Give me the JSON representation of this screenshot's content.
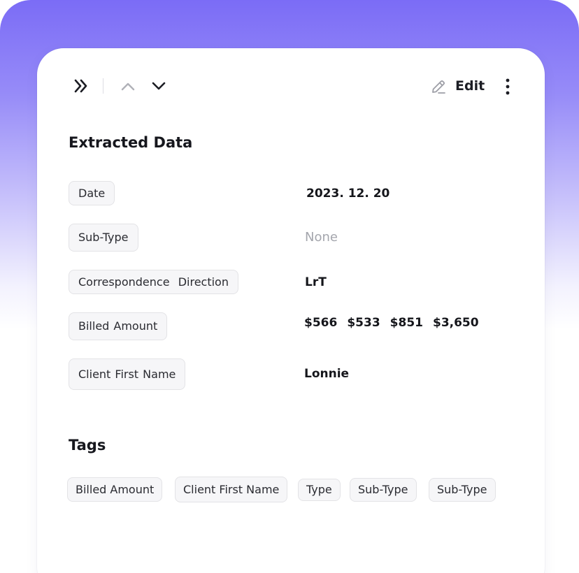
{
  "toolbar": {
    "expand_icon": "double-chevron-right-icon",
    "prev_icon": "chevron-up-icon",
    "next_icon": "chevron-down-icon",
    "edit_icon": "pencil-icon",
    "edit_label": "Edit",
    "more_icon": "more-vertical-icon"
  },
  "extracted": {
    "title": "Extracted Data",
    "fields": [
      {
        "label": "Date",
        "value": "2023. 12. 20"
      },
      {
        "label": "Sub-Type",
        "value": "None"
      },
      {
        "label": "Correspondence  Direction",
        "value": "LrT"
      },
      {
        "label": "Billed Amount",
        "values": [
          "$566",
          "$533",
          "$851",
          "$3,650"
        ]
      },
      {
        "label": "Client First Name",
        "value": "Lonnie"
      }
    ]
  },
  "tags": {
    "title": "Tags",
    "items": [
      "Billed Amount",
      "Client First Name",
      "Type",
      "Sub-Type",
      "Sub-Type"
    ]
  },
  "colors": {
    "gradient_top": "#7b6cf6",
    "text_primary": "#16171d",
    "text_muted": "#a4a6ad",
    "chip_bg": "#f6f6f8",
    "chip_border": "#e3e3e6"
  }
}
